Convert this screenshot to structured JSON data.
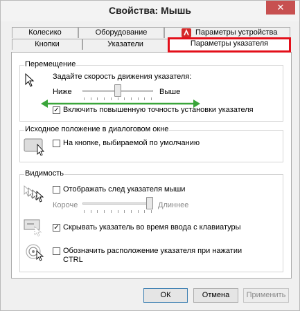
{
  "window": {
    "title": "Свойства: Мышь",
    "close_glyph": "✕"
  },
  "tabs_top": [
    {
      "label": "Колесико"
    },
    {
      "label": "Оборудование"
    },
    {
      "label": "Параметры устройства"
    }
  ],
  "tabs_bottom": [
    {
      "label": "Кнопки"
    },
    {
      "label": "Указатели"
    },
    {
      "label": "Параметры указателя",
      "active": true
    }
  ],
  "motion": {
    "group_title": "Перемещение",
    "speed_label": "Задайте скорость движения указателя:",
    "slow": "Ниже",
    "fast": "Выше",
    "speed_level": 0.5,
    "precision_label": "Включить повышенную точность установки указателя",
    "precision_checked": "✓"
  },
  "snap": {
    "group_title": "Исходное положение в диалоговом окне",
    "label": "На кнопке, выбираемой по умолчанию",
    "checked": ""
  },
  "visibility": {
    "group_title": "Видимость",
    "trails_label": "Отображать след указателя мыши",
    "trails_checked": "",
    "short": "Короче",
    "long": "Длиннее",
    "trails_level": 1.0,
    "hide_label": "Скрывать указатель во время ввода с клавиатуры",
    "hide_checked": "✓",
    "ctrl_label": "Обозначить расположение указателя при нажатии CTRL",
    "ctrl_checked": ""
  },
  "buttons": {
    "ok": "ОК",
    "cancel": "Отмена",
    "apply": "Применить"
  },
  "colors": {
    "highlight_red": "#e30f1a",
    "arrow_green": "#3aa53a"
  }
}
